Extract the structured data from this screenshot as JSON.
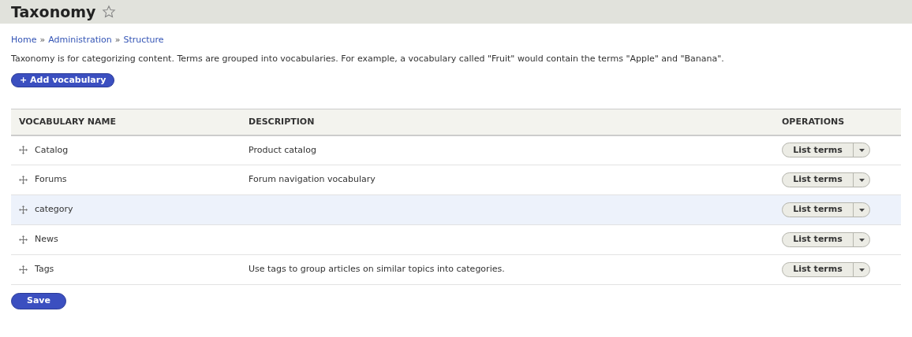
{
  "page_title": "Taxonomy",
  "breadcrumb": [
    "Home",
    "Administration",
    "Structure"
  ],
  "breadcrumb_separator": "»",
  "description": "Taxonomy is for categorizing content. Terms are grouped into vocabularies. For example, a vocabulary called \"Fruit\" would contain the terms \"Apple\" and \"Banana\".",
  "add_button": "+ Add vocabulary",
  "table": {
    "columns": [
      "VOCABULARY NAME",
      "DESCRIPTION",
      "OPERATIONS"
    ],
    "rows": [
      {
        "name": "Catalog",
        "description": "Product catalog",
        "operation": "List terms",
        "highlighted": false
      },
      {
        "name": "Forums",
        "description": "Forum navigation vocabulary",
        "operation": "List terms",
        "highlighted": false
      },
      {
        "name": "category",
        "operation": "List terms",
        "highlighted": true
      },
      {
        "name": "News",
        "operation": "List terms",
        "highlighted": false
      },
      {
        "name": "Tags",
        "description": "Use tags to group articles on similar topics into categories.",
        "operation": "List terms",
        "highlighted": false
      }
    ]
  },
  "save_button": "Save"
}
